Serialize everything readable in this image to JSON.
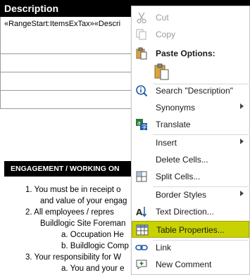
{
  "document": {
    "header_title": "Description",
    "range_text": "«RangeStart:ItemsExTax»«Descri",
    "engagement_title": "ENGAGEMENT / WORKING ON",
    "lines": [
      "1.   You must be in receipt o",
      "and value of your engag",
      "2.   All  employees  /  repres",
      "Buildlogic Site Foreman",
      "a.    Occupation He",
      "b.    Buildlogic Comp",
      "3.   Your responsibility for W",
      "a.    You and your e"
    ]
  },
  "context_menu": {
    "items": {
      "cut": "Cut",
      "copy": "Copy",
      "paste_options": "Paste Options:",
      "search": "Search \"Description\"",
      "synonyms": "Synonyms",
      "translate": "Translate",
      "insert": "Insert",
      "delete_cells": "Delete Cells...",
      "split_cells": "Split Cells...",
      "border_styles": "Border Styles",
      "text_direction": "Text Direction...",
      "table_properties": "Table Properties...",
      "link": "Link",
      "new_comment": "New Comment"
    },
    "highlight_color": "#c8d200"
  }
}
